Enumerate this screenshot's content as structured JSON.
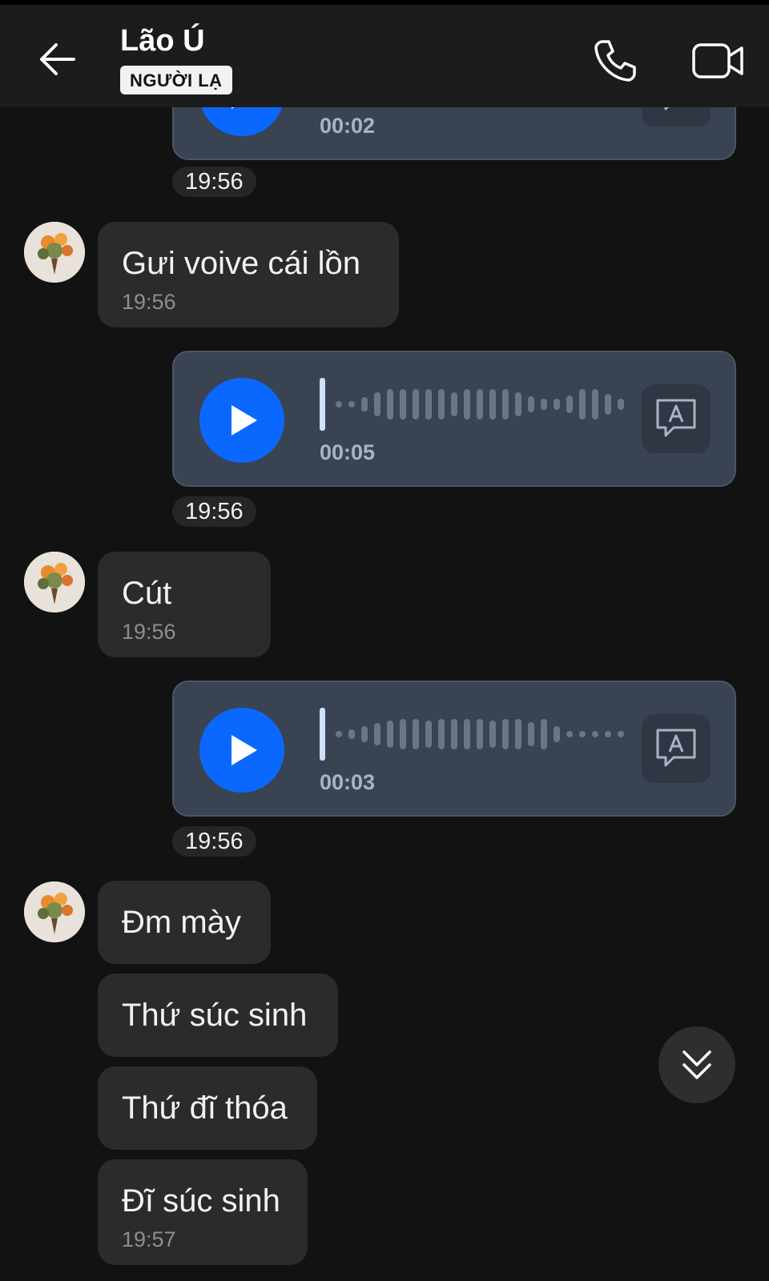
{
  "header": {
    "title": "Lão Ú",
    "badge": "NGƯỜI LẠ",
    "back_icon": "arrow-left-icon",
    "call_icon": "phone-icon",
    "video_icon": "video-camera-icon"
  },
  "messages": {
    "voice0": {
      "duration": "00:02",
      "time": "19:56"
    },
    "msg1": {
      "text": "Gưi voive cái lồn",
      "time": "19:56"
    },
    "voice1": {
      "duration": "00:05",
      "time": "19:56"
    },
    "msg2": {
      "text": "Cút",
      "time": "19:56"
    },
    "voice2": {
      "duration": "00:03",
      "time": "19:56"
    },
    "msg3": {
      "text": "Đm mày"
    },
    "msg4": {
      "text": "Thứ súc sinh"
    },
    "msg5": {
      "text": "Thứ đĩ thóa"
    },
    "msg6": {
      "text": "Đĩ súc sinh",
      "time": "19:57"
    }
  },
  "colors": {
    "play_button": "#0a68ff",
    "voice_bubble": "#3a4352",
    "incoming_bubble": "#2b2b2b",
    "background": "#121212"
  },
  "icons": {
    "play": "play-icon",
    "transcribe": "transcribe-text-icon",
    "scroll_down": "double-chevron-down-icon",
    "avatar": "flower-bouquet-avatar"
  }
}
